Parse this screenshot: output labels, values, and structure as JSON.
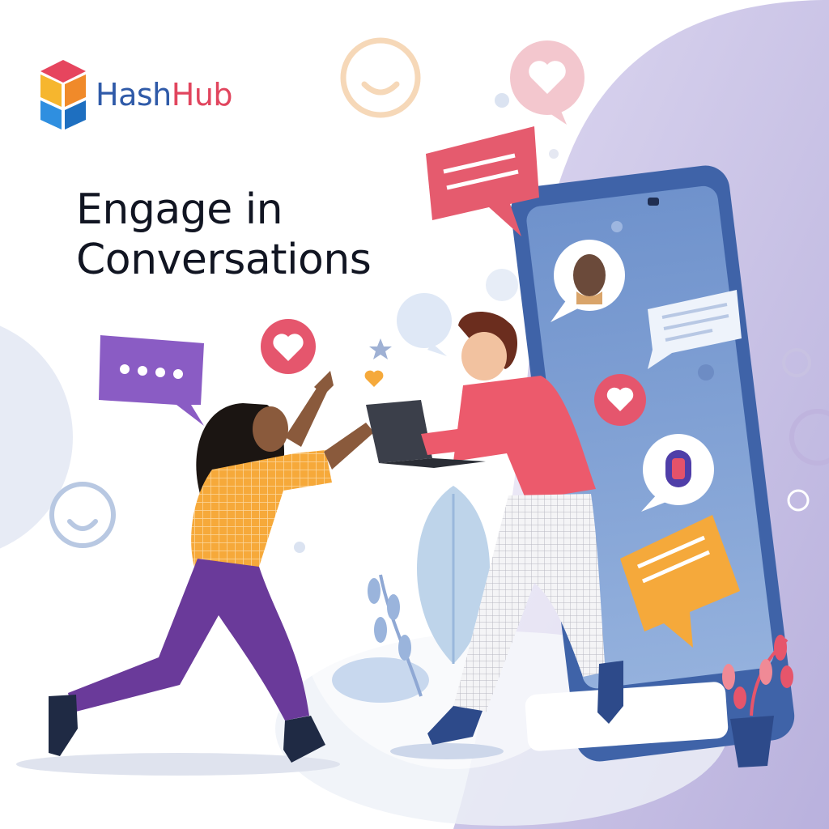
{
  "brand": {
    "name_part1": "Hash",
    "name_part2": "Hub",
    "colors": {
      "hash": "#2f5aa8",
      "hub": "#e1455e"
    },
    "logo_icon": "stacked-cube-icon"
  },
  "headline": {
    "line1": "Engage in",
    "line2": "Conversations"
  },
  "palette": {
    "phone_body": "#3f63a8",
    "phone_screen": "#7a9cd2",
    "background_blob": "#c9c1e6",
    "accent_pink": "#e6556b",
    "accent_purple": "#8a5cc4",
    "accent_orange": "#f5a93b"
  },
  "illustration": {
    "elements": [
      "smartphone-icon",
      "chat-bubble-icon",
      "heart-icon",
      "smiley-icon",
      "typing-bubble-icon",
      "woman-high-five-figure",
      "man-with-laptop-figure",
      "plant-icon"
    ]
  }
}
